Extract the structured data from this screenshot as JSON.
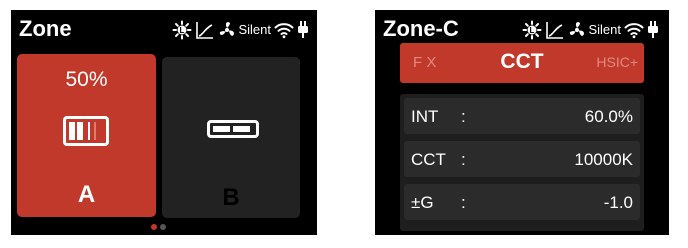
{
  "status_icons": {
    "fan_label": "Silent",
    "icons": [
      "light-sensor-icon",
      "dimming-curve-icon",
      "fan-icon",
      "wifi-icon",
      "power-plug-icon"
    ]
  },
  "left_screen": {
    "title": "Zone",
    "zones": [
      {
        "letter": "A",
        "percent": "50%",
        "selected": true,
        "color": "#c0392b",
        "level": 0.5
      },
      {
        "letter": "B",
        "percent": "",
        "selected": false,
        "color": "#222222"
      }
    ],
    "page_indicator": {
      "current": 1,
      "total": 2
    }
  },
  "right_screen": {
    "title": "Zone-C",
    "mode_bar": {
      "left": "F X",
      "center": "CCT",
      "right": "HSIC+"
    },
    "params": [
      {
        "label": "INT",
        "colon": ":",
        "value": "60.0%"
      },
      {
        "label": "CCT",
        "colon": ":",
        "value": "10000K"
      },
      {
        "label": "±G",
        "colon": ":",
        "value": "-1.0"
      }
    ]
  },
  "colors": {
    "accent": "#c0392b",
    "background": "#000000",
    "card": "#222222",
    "row": "#2b2b2b"
  }
}
